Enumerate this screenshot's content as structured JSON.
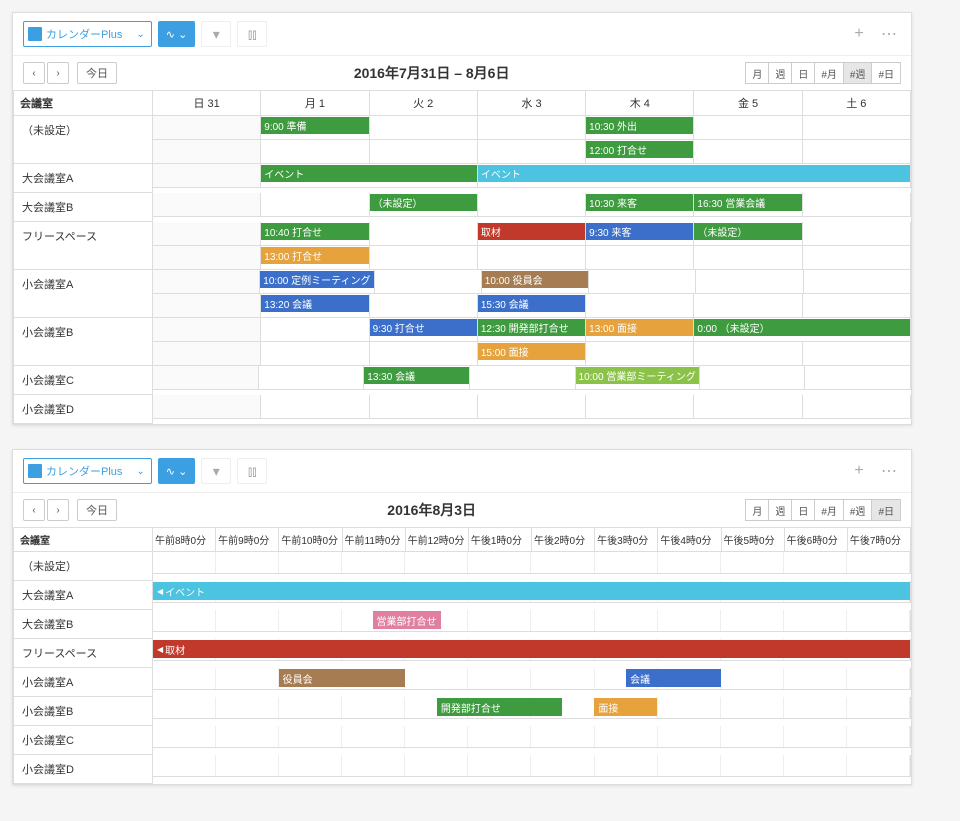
{
  "app": {
    "name": "カレンダーPlus"
  },
  "top": {
    "title": "2016年7月31日 – 8月6日",
    "today": "今日",
    "views": {
      "m": "月",
      "w": "週",
      "d": "日",
      "hm": "#月",
      "hw": "#週",
      "hd": "#日"
    },
    "active_view": "hw",
    "resource_header": "会議室",
    "day_headers": [
      "日 31",
      "月 1",
      "火 2",
      "水 3",
      "木 4",
      "金 5",
      "土 6"
    ],
    "resources": [
      "（未設定）",
      "大会議室A",
      "大会議室B",
      "フリースペース",
      "小会議室A",
      "小会議室B",
      "小会議室C",
      "小会議室D"
    ],
    "events": {
      "r0": [
        {
          "day": 1,
          "span": 1,
          "txt": "9:00 準備",
          "cls": "g-green"
        },
        {
          "day": 4,
          "span": 1,
          "txt": "10:30 外出",
          "cls": "g-green"
        },
        {
          "day": 4,
          "span": 1,
          "txt": "12:00 打合せ",
          "cls": "g-green",
          "stack": 1
        }
      ],
      "r1": [
        {
          "day": 1,
          "span": 2,
          "txt": "イベント",
          "cls": "g-green"
        },
        {
          "day": 3,
          "span": 4,
          "txt": "イベント",
          "cls": "g-cyan"
        }
      ],
      "r2": [
        {
          "day": 2,
          "span": 1,
          "txt": "（未設定）",
          "cls": "g-green"
        },
        {
          "day": 4,
          "span": 1,
          "txt": "10:30 来客",
          "cls": "g-green"
        },
        {
          "day": 5,
          "span": 1,
          "txt": "16:30 営業会議",
          "cls": "g-green"
        }
      ],
      "r3": [
        {
          "day": 1,
          "span": 1,
          "txt": "10:40 打合せ",
          "cls": "g-green"
        },
        {
          "day": 1,
          "span": 1,
          "txt": "13:00 打合せ",
          "cls": "g-orange",
          "stack": 1
        },
        {
          "day": 3,
          "span": 1,
          "txt": "取材",
          "cls": "g-red"
        },
        {
          "day": 4,
          "span": 1,
          "txt": "9:30 来客",
          "cls": "g-blue"
        },
        {
          "day": 5,
          "span": 1,
          "txt": "（未設定）",
          "cls": "g-green"
        }
      ],
      "r4": [
        {
          "day": 1,
          "span": 1,
          "txt": "10:00 定例ミーティング",
          "cls": "g-blue"
        },
        {
          "day": 1,
          "span": 1,
          "txt": "13:20 会議",
          "cls": "g-blue",
          "stack": 1
        },
        {
          "day": 3,
          "span": 1,
          "txt": "10:00 役員会",
          "cls": "g-brown"
        },
        {
          "day": 3,
          "span": 1,
          "txt": "15:30 会議",
          "cls": "g-blue",
          "stack": 1
        }
      ],
      "r5": [
        {
          "day": 2,
          "span": 1,
          "txt": "9:30 打合せ",
          "cls": "g-blue"
        },
        {
          "day": 3,
          "span": 1,
          "txt": "12:30 開発部打合せ",
          "cls": "g-green"
        },
        {
          "day": 3,
          "span": 1,
          "txt": "15:00 面接",
          "cls": "g-orange",
          "stack": 1
        },
        {
          "day": 4,
          "span": 1,
          "txt": "13:00 面接",
          "cls": "g-orange"
        },
        {
          "day": 5,
          "span": 2,
          "txt": "0:00 （未設定）",
          "cls": "g-green"
        }
      ],
      "r6": [
        {
          "day": 2,
          "span": 1,
          "txt": "13:30 会議",
          "cls": "g-green"
        },
        {
          "day": 4,
          "span": 1,
          "txt": "10:00 営業部ミーティング",
          "cls": "g-lgreen"
        }
      ],
      "r7": []
    }
  },
  "bottom": {
    "title": "2016年8月3日",
    "today": "今日",
    "views": {
      "m": "月",
      "w": "週",
      "d": "日",
      "hm": "#月",
      "hw": "#週",
      "hd": "#日"
    },
    "active_view": "hd",
    "resource_header": "会議室",
    "hours": [
      "午前8時0分",
      "午前9時0分",
      "午前10時0分",
      "午前11時0分",
      "午前12時0分",
      "午後1時0分",
      "午後2時0分",
      "午後3時0分",
      "午後4時0分",
      "午後5時0分",
      "午後6時0分",
      "午後7時0分"
    ],
    "resources": [
      "（未設定）",
      "大会議室A",
      "大会議室B",
      "フリースペース",
      "小会議室A",
      "小会議室B",
      "小会議室C",
      "小会議室D"
    ],
    "events": {
      "r0": [],
      "r1": [
        {
          "start": 0,
          "end": 100,
          "txt": "イベント",
          "cls": "g-cyan",
          "arrow": true
        }
      ],
      "r2": [
        {
          "start": 29,
          "end": 38,
          "txt": "営業部打合せ",
          "cls": "g-pink"
        }
      ],
      "r3": [
        {
          "start": 0,
          "end": 100,
          "txt": "取材",
          "cls": "g-red",
          "arrow": true
        }
      ],
      "r4": [
        {
          "start": 16.6,
          "end": 33.3,
          "txt": "役員会",
          "cls": "g-brown"
        },
        {
          "start": 62.5,
          "end": 75,
          "txt": "会議",
          "cls": "g-blue"
        }
      ],
      "r5": [
        {
          "start": 37.5,
          "end": 54,
          "txt": "開発部打合せ",
          "cls": "g-green"
        },
        {
          "start": 58.3,
          "end": 66.6,
          "txt": "面接",
          "cls": "g-orange"
        }
      ],
      "r6": [],
      "r7": []
    }
  }
}
